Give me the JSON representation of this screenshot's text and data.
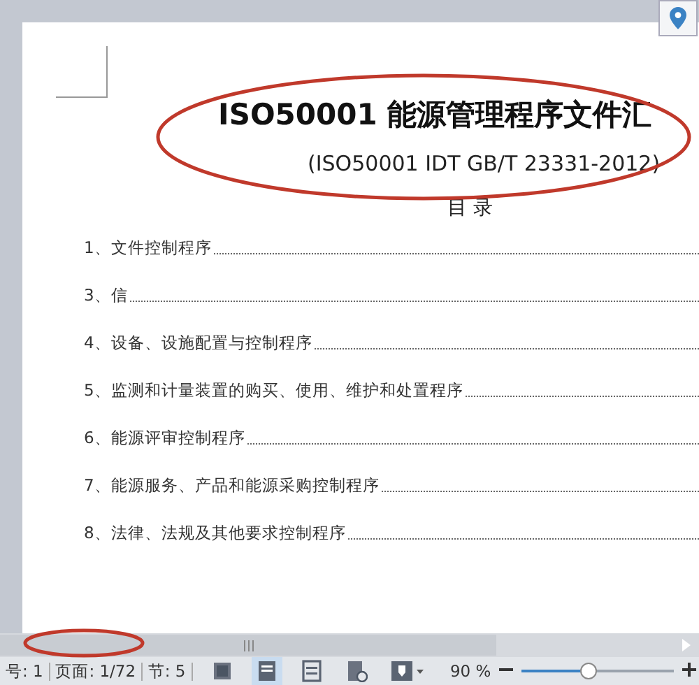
{
  "document": {
    "title": "ISO50001 能源管理程序文件汇",
    "subtitle": "(ISO50001 IDT GB/T 23331-2012)",
    "toc_heading": "目 录",
    "toc_items": [
      {
        "text": "1、文件控制程序"
      },
      {
        "text": "3、信"
      },
      {
        "text": "4、设备、设施配置与控制程序"
      },
      {
        "text": "5、监测和计量装置的购买、使用、维护和处置程序"
      },
      {
        "text": "6、能源评审控制程序"
      },
      {
        "text": "7、能源服务、产品和能源采购控制程序"
      },
      {
        "text": "8、法律、法规及其他要求控制程序"
      }
    ]
  },
  "status_bar": {
    "page_number": "号: 1",
    "pages": "页面: 1/72",
    "section": "节: 5",
    "view_buttons": [
      {
        "kind": "fullscreen",
        "selected": false
      },
      {
        "kind": "page",
        "selected": true
      },
      {
        "kind": "outline",
        "selected": false
      },
      {
        "kind": "web",
        "selected": false
      }
    ],
    "zoom": "90 %",
    "zoom_slider": {
      "level": 0.44
    }
  }
}
